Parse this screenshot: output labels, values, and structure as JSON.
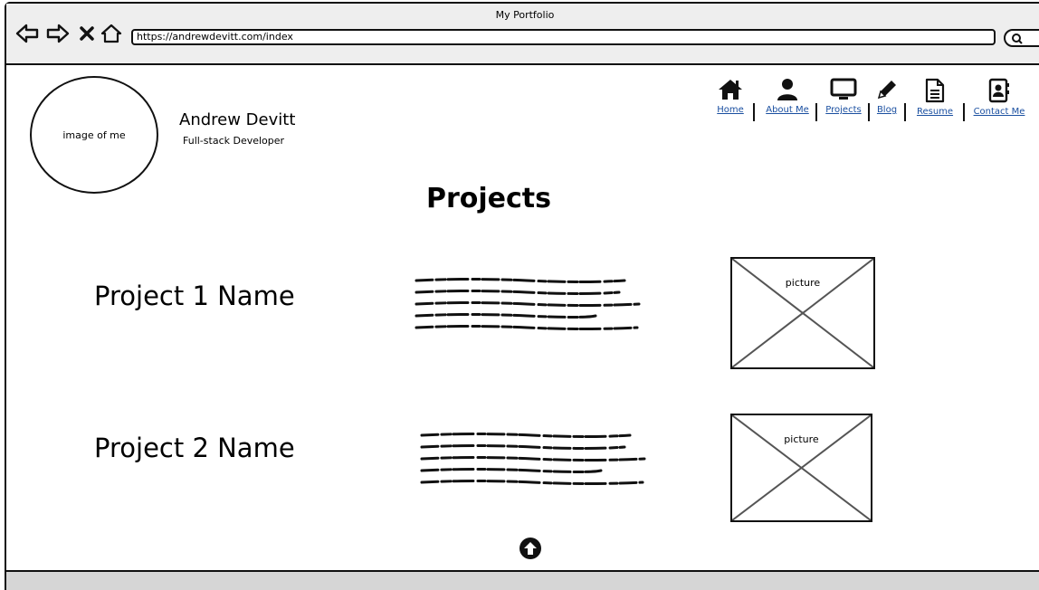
{
  "browser": {
    "title": "My Portfolio",
    "url": "https://andrewdevitt.com/index"
  },
  "header": {
    "avatar_label": "image of me",
    "name": "Andrew Devitt",
    "role": "Full-stack Developer"
  },
  "nav": {
    "items": [
      {
        "label": "Home",
        "icon": "home-icon"
      },
      {
        "label": "About Me",
        "icon": "user-icon"
      },
      {
        "label": "Projects",
        "icon": "monitor-icon"
      },
      {
        "label": "Blog",
        "icon": "pencil-icon"
      },
      {
        "label": "Resume",
        "icon": "document-icon"
      },
      {
        "label": "Contact Me",
        "icon": "address-book-icon"
      }
    ]
  },
  "main": {
    "title": "Projects",
    "projects": [
      {
        "name": "Project 1 Name",
        "picture_label": "picture"
      },
      {
        "name": "Project 2 Name",
        "picture_label": "picture"
      }
    ]
  },
  "icons": {
    "back": "back-arrow-icon",
    "forward": "forward-arrow-icon",
    "stop": "close-icon",
    "home": "home-outline-icon",
    "search": "search-icon",
    "scroll_top": "arrow-up-circle-icon"
  }
}
